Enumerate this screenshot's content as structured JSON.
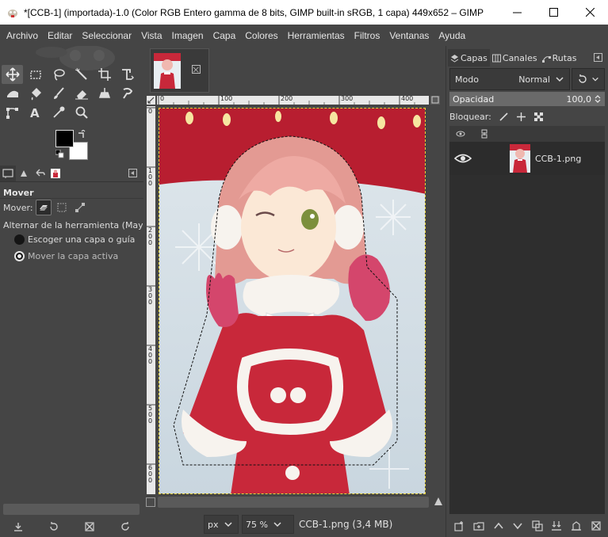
{
  "window": {
    "title": "*[CCB-1] (importada)-1.0 (Color RGB Entero gamma de 8 bits, GIMP built-in sRGB, 1 capa) 449x652 – GIMP"
  },
  "menu": [
    "Archivo",
    "Editar",
    "Seleccionar",
    "Vista",
    "Imagen",
    "Capa",
    "Colores",
    "Herramientas",
    "Filtros",
    "Ventanas",
    "Ayuda"
  ],
  "tool_options": {
    "title": "Mover",
    "mover_label": "Mover:",
    "toggle_label": "Alternar de la herramienta  (Mayús)",
    "option_pick": "Escoger una capa o guía",
    "option_active": "Mover la capa activa"
  },
  "ruler": {
    "h_ticks": [
      "0",
      "100",
      "200",
      "300",
      "400"
    ],
    "v_ticks": [
      "0",
      "1\n0\n0",
      "2\n0\n0",
      "3\n0\n0",
      "4\n0\n0",
      "5\n0\n0",
      "6\n0\n0"
    ]
  },
  "statusbar": {
    "unit": "px",
    "zoom": "75 %",
    "file_info": "CCB-1.png (3,4 MB)"
  },
  "dock": {
    "tabs": [
      "Capas",
      "Canales",
      "Rutas"
    ],
    "mode_label": "Modo",
    "mode_value": "Normal",
    "opacity_label": "Opacidad",
    "opacity_value": "100,0",
    "lock_label": "Bloquear:",
    "layers": [
      {
        "name": "CCB-1.png",
        "visible": true
      }
    ]
  },
  "colors": {
    "panel_bg": "#454545",
    "dark_bg": "#2e2e2e",
    "selection": "#e6d23a",
    "canvas_red": "#c8283a"
  }
}
